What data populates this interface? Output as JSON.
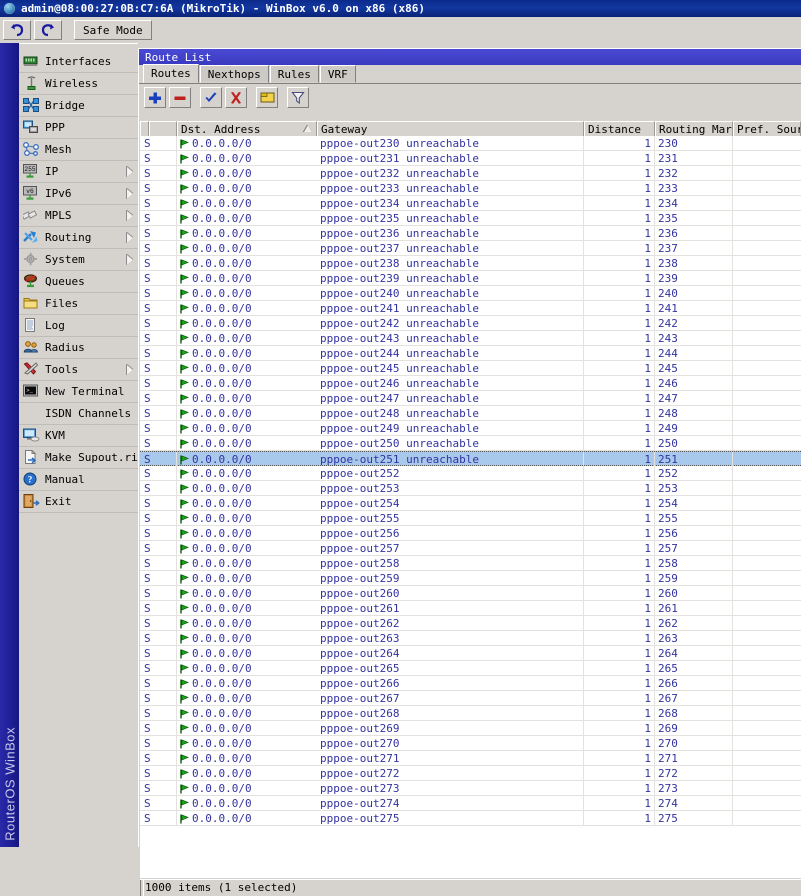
{
  "window": {
    "title": "admin@08:00:27:0B:C7:6A (MikroTik) - WinBox v6.0 on x86 (x86)",
    "app_icon": "winbox-globe-icon"
  },
  "main_toolbar": {
    "undo_label": "undo-icon",
    "redo_label": "redo-icon",
    "safe_mode_label": "Safe Mode"
  },
  "branding": {
    "vertical_text": "RouterOS WinBox"
  },
  "sidebar": {
    "items": [
      {
        "label": "Interfaces",
        "icon": "network-card-icon",
        "submenu": false
      },
      {
        "label": "Wireless",
        "icon": "antenna-icon",
        "submenu": false
      },
      {
        "label": "Bridge",
        "icon": "bridge-icon",
        "submenu": false
      },
      {
        "label": "PPP",
        "icon": "ppp-icon",
        "submenu": false
      },
      {
        "label": "Mesh",
        "icon": "mesh-icon",
        "submenu": false
      },
      {
        "label": "IP",
        "icon": "ip-255-icon",
        "submenu": true
      },
      {
        "label": "IPv6",
        "icon": "ipv6-icon",
        "submenu": true
      },
      {
        "label": "MPLS",
        "icon": "mpls-labels-icon",
        "submenu": true
      },
      {
        "label": "Routing",
        "icon": "routing-arrows-icon",
        "submenu": true
      },
      {
        "label": "System",
        "icon": "gear-icon",
        "submenu": true
      },
      {
        "label": "Queues",
        "icon": "queues-icon",
        "submenu": false
      },
      {
        "label": "Files",
        "icon": "folder-icon",
        "submenu": false
      },
      {
        "label": "Log",
        "icon": "log-page-icon",
        "submenu": false
      },
      {
        "label": "Radius",
        "icon": "radius-users-icon",
        "submenu": false
      },
      {
        "label": "Tools",
        "icon": "tools-wrench-icon",
        "submenu": true
      },
      {
        "label": "New Terminal",
        "icon": "terminal-icon",
        "submenu": false
      },
      {
        "label": "ISDN Channels",
        "icon": "none",
        "submenu": false
      },
      {
        "label": "KVM",
        "icon": "kvm-monitor-icon",
        "submenu": false
      },
      {
        "label": "Make Supout.rif",
        "icon": "export-file-icon",
        "submenu": false
      },
      {
        "label": "Manual",
        "icon": "help-question-icon",
        "submenu": false
      },
      {
        "label": "Exit",
        "icon": "exit-door-icon",
        "submenu": false
      }
    ]
  },
  "route_list": {
    "title": "Route List",
    "tabs": [
      {
        "label": "Routes",
        "active": true
      },
      {
        "label": "Nexthops",
        "active": false
      },
      {
        "label": "Rules",
        "active": false
      },
      {
        "label": "VRF",
        "active": false
      }
    ],
    "toolbar_buttons": [
      {
        "name": "add-button",
        "icon": "plus-icon"
      },
      {
        "name": "remove-button",
        "icon": "minus-icon"
      },
      {
        "name": "enable-button",
        "icon": "check-icon"
      },
      {
        "name": "disable-button",
        "icon": "x-icon"
      },
      {
        "name": "comment-button",
        "icon": "comment-note-icon"
      },
      {
        "name": "filter-button",
        "icon": "funnel-icon"
      }
    ],
    "columns": [
      {
        "key": "flags",
        "label": ""
      },
      {
        "key": "dst",
        "label": "Dst. Address",
        "sorted": true
      },
      {
        "key": "gateway",
        "label": "Gateway"
      },
      {
        "key": "distance",
        "label": "Distance"
      },
      {
        "key": "routing_mark",
        "label": "Routing Mark"
      },
      {
        "key": "pref_source",
        "label": "Pref. Source"
      }
    ],
    "rows": [
      {
        "flags": "S",
        "dst": "0.0.0.0/0",
        "gateway": "pppoe-out230 unreachable",
        "distance": "1",
        "routing_mark": "230",
        "pref_source": "",
        "selected": false
      },
      {
        "flags": "S",
        "dst": "0.0.0.0/0",
        "gateway": "pppoe-out231 unreachable",
        "distance": "1",
        "routing_mark": "231",
        "pref_source": "",
        "selected": false
      },
      {
        "flags": "S",
        "dst": "0.0.0.0/0",
        "gateway": "pppoe-out232 unreachable",
        "distance": "1",
        "routing_mark": "232",
        "pref_source": "",
        "selected": false
      },
      {
        "flags": "S",
        "dst": "0.0.0.0/0",
        "gateway": "pppoe-out233 unreachable",
        "distance": "1",
        "routing_mark": "233",
        "pref_source": "",
        "selected": false
      },
      {
        "flags": "S",
        "dst": "0.0.0.0/0",
        "gateway": "pppoe-out234 unreachable",
        "distance": "1",
        "routing_mark": "234",
        "pref_source": "",
        "selected": false
      },
      {
        "flags": "S",
        "dst": "0.0.0.0/0",
        "gateway": "pppoe-out235 unreachable",
        "distance": "1",
        "routing_mark": "235",
        "pref_source": "",
        "selected": false
      },
      {
        "flags": "S",
        "dst": "0.0.0.0/0",
        "gateway": "pppoe-out236 unreachable",
        "distance": "1",
        "routing_mark": "236",
        "pref_source": "",
        "selected": false
      },
      {
        "flags": "S",
        "dst": "0.0.0.0/0",
        "gateway": "pppoe-out237 unreachable",
        "distance": "1",
        "routing_mark": "237",
        "pref_source": "",
        "selected": false
      },
      {
        "flags": "S",
        "dst": "0.0.0.0/0",
        "gateway": "pppoe-out238 unreachable",
        "distance": "1",
        "routing_mark": "238",
        "pref_source": "",
        "selected": false
      },
      {
        "flags": "S",
        "dst": "0.0.0.0/0",
        "gateway": "pppoe-out239 unreachable",
        "distance": "1",
        "routing_mark": "239",
        "pref_source": "",
        "selected": false
      },
      {
        "flags": "S",
        "dst": "0.0.0.0/0",
        "gateway": "pppoe-out240 unreachable",
        "distance": "1",
        "routing_mark": "240",
        "pref_source": "",
        "selected": false
      },
      {
        "flags": "S",
        "dst": "0.0.0.0/0",
        "gateway": "pppoe-out241 unreachable",
        "distance": "1",
        "routing_mark": "241",
        "pref_source": "",
        "selected": false
      },
      {
        "flags": "S",
        "dst": "0.0.0.0/0",
        "gateway": "pppoe-out242 unreachable",
        "distance": "1",
        "routing_mark": "242",
        "pref_source": "",
        "selected": false
      },
      {
        "flags": "S",
        "dst": "0.0.0.0/0",
        "gateway": "pppoe-out243 unreachable",
        "distance": "1",
        "routing_mark": "243",
        "pref_source": "",
        "selected": false
      },
      {
        "flags": "S",
        "dst": "0.0.0.0/0",
        "gateway": "pppoe-out244 unreachable",
        "distance": "1",
        "routing_mark": "244",
        "pref_source": "",
        "selected": false
      },
      {
        "flags": "S",
        "dst": "0.0.0.0/0",
        "gateway": "pppoe-out245 unreachable",
        "distance": "1",
        "routing_mark": "245",
        "pref_source": "",
        "selected": false
      },
      {
        "flags": "S",
        "dst": "0.0.0.0/0",
        "gateway": "pppoe-out246 unreachable",
        "distance": "1",
        "routing_mark": "246",
        "pref_source": "",
        "selected": false
      },
      {
        "flags": "S",
        "dst": "0.0.0.0/0",
        "gateway": "pppoe-out247 unreachable",
        "distance": "1",
        "routing_mark": "247",
        "pref_source": "",
        "selected": false
      },
      {
        "flags": "S",
        "dst": "0.0.0.0/0",
        "gateway": "pppoe-out248 unreachable",
        "distance": "1",
        "routing_mark": "248",
        "pref_source": "",
        "selected": false
      },
      {
        "flags": "S",
        "dst": "0.0.0.0/0",
        "gateway": "pppoe-out249 unreachable",
        "distance": "1",
        "routing_mark": "249",
        "pref_source": "",
        "selected": false
      },
      {
        "flags": "S",
        "dst": "0.0.0.0/0",
        "gateway": "pppoe-out250 unreachable",
        "distance": "1",
        "routing_mark": "250",
        "pref_source": "",
        "selected": false
      },
      {
        "flags": "S",
        "dst": "0.0.0.0/0",
        "gateway": "pppoe-out251 unreachable",
        "distance": "1",
        "routing_mark": "251",
        "pref_source": "",
        "selected": true
      },
      {
        "flags": "S",
        "dst": "0.0.0.0/0",
        "gateway": "pppoe-out252",
        "distance": "1",
        "routing_mark": "252",
        "pref_source": "",
        "selected": false
      },
      {
        "flags": "S",
        "dst": "0.0.0.0/0",
        "gateway": "pppoe-out253",
        "distance": "1",
        "routing_mark": "253",
        "pref_source": "",
        "selected": false
      },
      {
        "flags": "S",
        "dst": "0.0.0.0/0",
        "gateway": "pppoe-out254",
        "distance": "1",
        "routing_mark": "254",
        "pref_source": "",
        "selected": false
      },
      {
        "flags": "S",
        "dst": "0.0.0.0/0",
        "gateway": "pppoe-out255",
        "distance": "1",
        "routing_mark": "255",
        "pref_source": "",
        "selected": false
      },
      {
        "flags": "S",
        "dst": "0.0.0.0/0",
        "gateway": "pppoe-out256",
        "distance": "1",
        "routing_mark": "256",
        "pref_source": "",
        "selected": false
      },
      {
        "flags": "S",
        "dst": "0.0.0.0/0",
        "gateway": "pppoe-out257",
        "distance": "1",
        "routing_mark": "257",
        "pref_source": "",
        "selected": false
      },
      {
        "flags": "S",
        "dst": "0.0.0.0/0",
        "gateway": "pppoe-out258",
        "distance": "1",
        "routing_mark": "258",
        "pref_source": "",
        "selected": false
      },
      {
        "flags": "S",
        "dst": "0.0.0.0/0",
        "gateway": "pppoe-out259",
        "distance": "1",
        "routing_mark": "259",
        "pref_source": "",
        "selected": false
      },
      {
        "flags": "S",
        "dst": "0.0.0.0/0",
        "gateway": "pppoe-out260",
        "distance": "1",
        "routing_mark": "260",
        "pref_source": "",
        "selected": false
      },
      {
        "flags": "S",
        "dst": "0.0.0.0/0",
        "gateway": "pppoe-out261",
        "distance": "1",
        "routing_mark": "261",
        "pref_source": "",
        "selected": false
      },
      {
        "flags": "S",
        "dst": "0.0.0.0/0",
        "gateway": "pppoe-out262",
        "distance": "1",
        "routing_mark": "262",
        "pref_source": "",
        "selected": false
      },
      {
        "flags": "S",
        "dst": "0.0.0.0/0",
        "gateway": "pppoe-out263",
        "distance": "1",
        "routing_mark": "263",
        "pref_source": "",
        "selected": false
      },
      {
        "flags": "S",
        "dst": "0.0.0.0/0",
        "gateway": "pppoe-out264",
        "distance": "1",
        "routing_mark": "264",
        "pref_source": "",
        "selected": false
      },
      {
        "flags": "S",
        "dst": "0.0.0.0/0",
        "gateway": "pppoe-out265",
        "distance": "1",
        "routing_mark": "265",
        "pref_source": "",
        "selected": false
      },
      {
        "flags": "S",
        "dst": "0.0.0.0/0",
        "gateway": "pppoe-out266",
        "distance": "1",
        "routing_mark": "266",
        "pref_source": "",
        "selected": false
      },
      {
        "flags": "S",
        "dst": "0.0.0.0/0",
        "gateway": "pppoe-out267",
        "distance": "1",
        "routing_mark": "267",
        "pref_source": "",
        "selected": false
      },
      {
        "flags": "S",
        "dst": "0.0.0.0/0",
        "gateway": "pppoe-out268",
        "distance": "1",
        "routing_mark": "268",
        "pref_source": "",
        "selected": false
      },
      {
        "flags": "S",
        "dst": "0.0.0.0/0",
        "gateway": "pppoe-out269",
        "distance": "1",
        "routing_mark": "269",
        "pref_source": "",
        "selected": false
      },
      {
        "flags": "S",
        "dst": "0.0.0.0/0",
        "gateway": "pppoe-out270",
        "distance": "1",
        "routing_mark": "270",
        "pref_source": "",
        "selected": false
      },
      {
        "flags": "S",
        "dst": "0.0.0.0/0",
        "gateway": "pppoe-out271",
        "distance": "1",
        "routing_mark": "271",
        "pref_source": "",
        "selected": false
      },
      {
        "flags": "S",
        "dst": "0.0.0.0/0",
        "gateway": "pppoe-out272",
        "distance": "1",
        "routing_mark": "272",
        "pref_source": "",
        "selected": false
      },
      {
        "flags": "S",
        "dst": "0.0.0.0/0",
        "gateway": "pppoe-out273",
        "distance": "1",
        "routing_mark": "273",
        "pref_source": "",
        "selected": false
      },
      {
        "flags": "S",
        "dst": "0.0.0.0/0",
        "gateway": "pppoe-out274",
        "distance": "1",
        "routing_mark": "274",
        "pref_source": "",
        "selected": false
      },
      {
        "flags": "S",
        "dst": "0.0.0.0/0",
        "gateway": "pppoe-out275",
        "distance": "1",
        "routing_mark": "275",
        "pref_source": "",
        "selected": false
      }
    ],
    "status_text": "1000 items (1 selected)"
  },
  "colors": {
    "title_blue": "#12379f",
    "window_title_blue": "#4040c8",
    "chrome_gray": "#d6d3ce",
    "row_text_blue": "#3333a0",
    "selection_blue": "#a8c8ec",
    "brand_blue": "#1e1e96",
    "flag_green": "#119911"
  }
}
